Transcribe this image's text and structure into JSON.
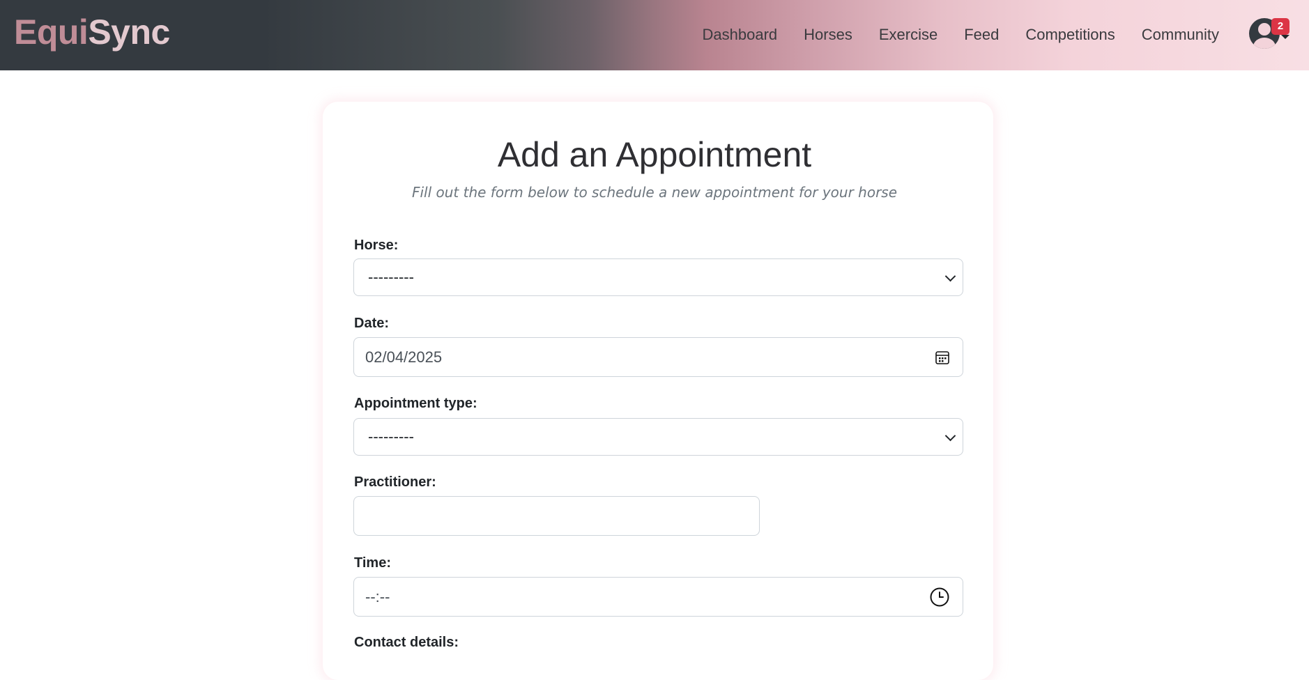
{
  "brand": {
    "part1": "Equi",
    "part2": "Sync"
  },
  "nav": {
    "links": [
      {
        "label": "Dashboard"
      },
      {
        "label": "Horses"
      },
      {
        "label": "Exercise"
      },
      {
        "label": "Feed"
      },
      {
        "label": "Competitions"
      },
      {
        "label": "Community"
      }
    ],
    "notifications_count": "2"
  },
  "form": {
    "title": "Add an Appointment",
    "subtitle": "Fill out the form below to schedule a new appointment for your horse",
    "horse": {
      "label": "Horse:",
      "value": "---------"
    },
    "date": {
      "label": "Date:",
      "value": "02/04/2025"
    },
    "appointment_type": {
      "label": "Appointment type:",
      "value": "---------"
    },
    "practitioner": {
      "label": "Practitioner:",
      "value": ""
    },
    "time": {
      "label": "Time:",
      "value": "--:--"
    },
    "contact_details": {
      "label": "Contact details:"
    }
  },
  "colors": {
    "brand_accent": "#c08d97",
    "nav_dark": "#343a40",
    "nav_light": "#f8dfe4",
    "badge": "#dc3545"
  },
  "icons": {
    "date": "calendar-icon",
    "time": "clock-icon",
    "select": "chevron-down-icon",
    "user": "user-avatar-icon"
  }
}
